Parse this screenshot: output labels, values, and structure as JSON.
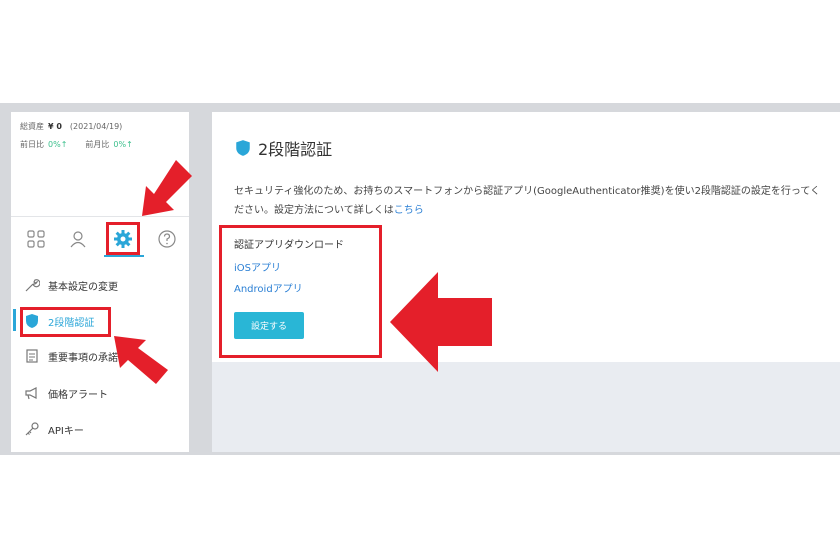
{
  "stats": {
    "total_label": "総資産",
    "total_value": "¥ 0",
    "date": "(2021/04/19)",
    "prev_day_label": "前日比",
    "prev_day_value": "0%↑",
    "prev_month_label": "前月比",
    "prev_month_value": "0%↑"
  },
  "tabs": [
    {
      "name": "grid-icon"
    },
    {
      "name": "user-icon"
    },
    {
      "name": "gear-icon",
      "active": true
    },
    {
      "name": "help-icon"
    }
  ],
  "menu": {
    "items": [
      {
        "label": "基本設定の変更",
        "icon": "wrench-icon"
      },
      {
        "label": "2段階認証",
        "icon": "shield-icon",
        "active": true
      },
      {
        "label": "重要事項の承諾",
        "icon": "document-icon"
      },
      {
        "label": "価格アラート",
        "icon": "megaphone-icon"
      },
      {
        "label": "APIキー",
        "icon": "key-icon"
      }
    ]
  },
  "main": {
    "title": "2段階認証",
    "description_main": "セキュリティ強化のため、お持ちのスマートフォンから認証アプリ(GoogleAuthenticator推奨)を使い2段階認証の設定を行ってください。設定方法について詳しくは",
    "description_link": "こちら",
    "download_title": "認証アプリダウンロード",
    "ios_link": "iOSアプリ",
    "android_link": "Androidアプリ",
    "setup_button": "設定する"
  },
  "colors": {
    "accent": "#29b6d6",
    "highlight_red": "#e41f2a",
    "link_blue": "#2a7fd4",
    "positive_green": "#3bbf8c"
  }
}
